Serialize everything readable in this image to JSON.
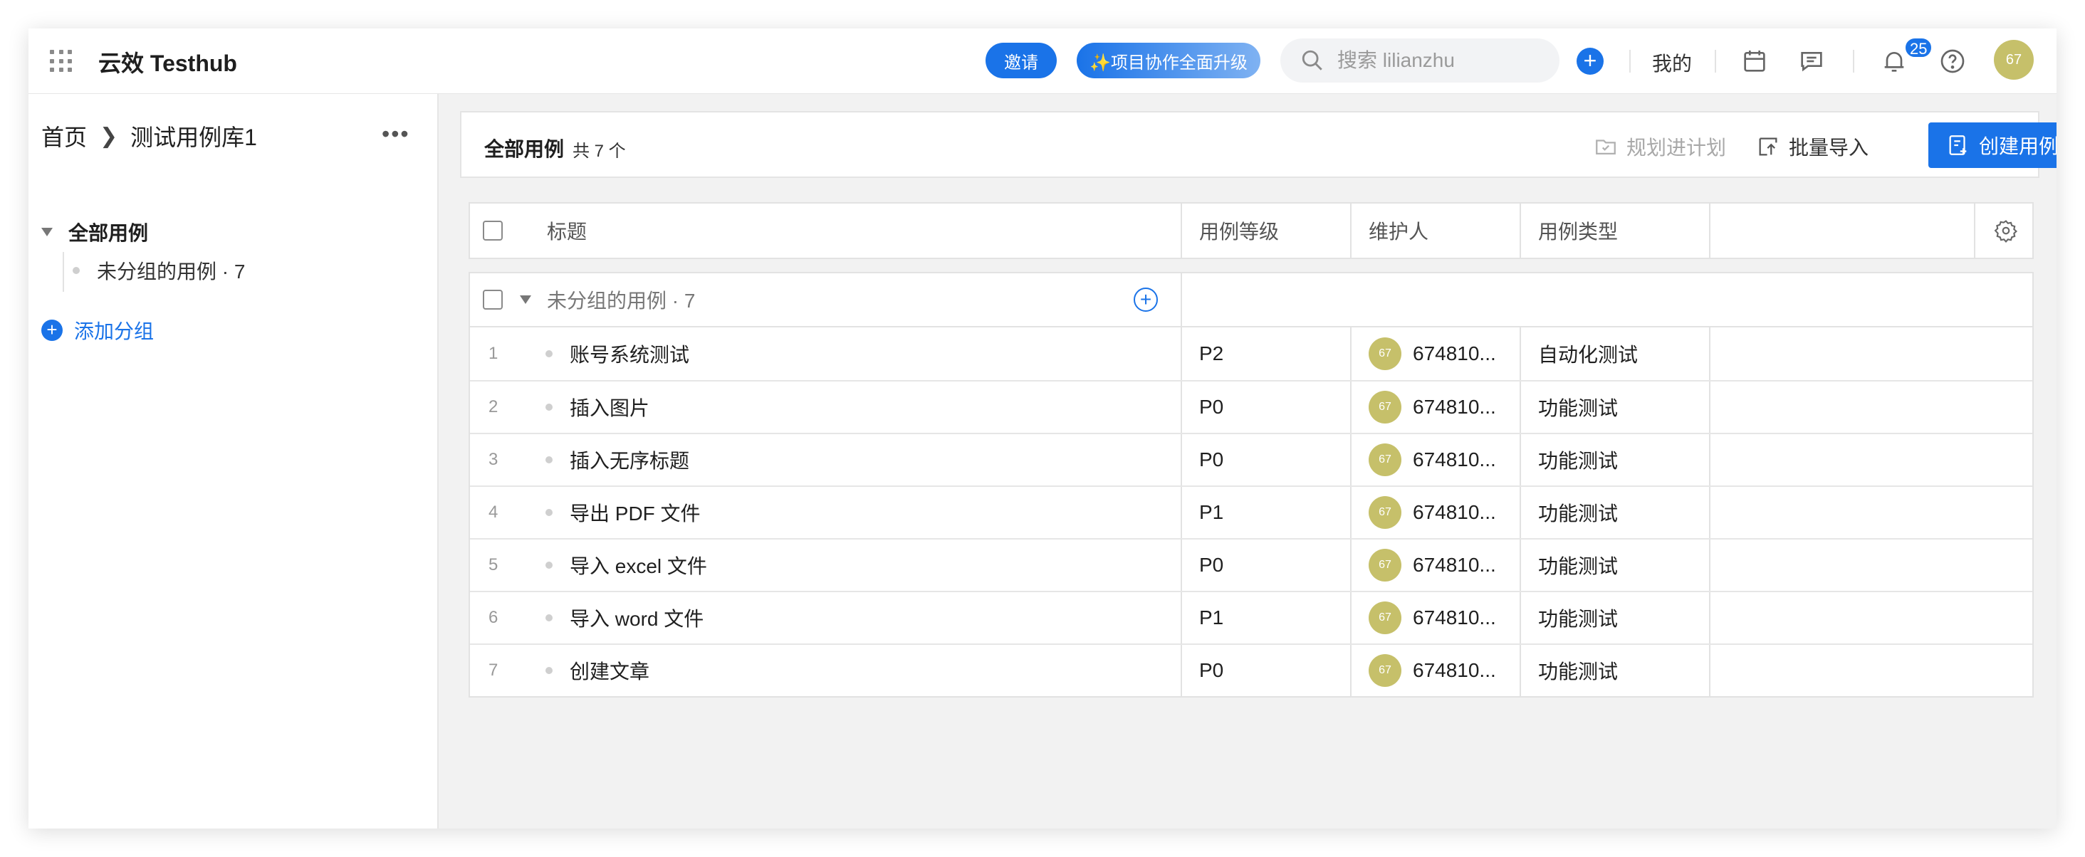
{
  "app": {
    "title": "云效 Testhub"
  },
  "topbar": {
    "invite_label": "邀请",
    "upgrade_label": "✨项目协作全面升级",
    "search_placeholder": "搜索 lilianzhu",
    "mine_label": "我的",
    "notification_count": "25",
    "avatar_text": "67"
  },
  "sidebar": {
    "breadcrumb": {
      "home": "首页",
      "library": "测试用例库1"
    },
    "tree_root": "全部用例",
    "tree_child": "未分组的用例 · 7",
    "add_group": "添加分组"
  },
  "main": {
    "title": "全部用例",
    "count": "共 7 个",
    "plan_label": "规划进计划",
    "import_label": "批量导入",
    "create_label": "创建用例"
  },
  "table": {
    "columns": {
      "title": "标题",
      "level": "用例等级",
      "maintainer": "维护人",
      "type": "用例类型"
    },
    "group_label": "未分组的用例 · 7",
    "rows": [
      {
        "num": "1",
        "title": "账号系统测试",
        "level": "P2",
        "avatar": "67",
        "maintainer": "674810...",
        "type": "自动化测试"
      },
      {
        "num": "2",
        "title": "插入图片",
        "level": "P0",
        "avatar": "67",
        "maintainer": "674810...",
        "type": "功能测试"
      },
      {
        "num": "3",
        "title": "插入无序标题",
        "level": "P0",
        "avatar": "67",
        "maintainer": "674810...",
        "type": "功能测试"
      },
      {
        "num": "4",
        "title": "导出 PDF 文件",
        "level": "P1",
        "avatar": "67",
        "maintainer": "674810...",
        "type": "功能测试"
      },
      {
        "num": "5",
        "title": "导入 excel 文件",
        "level": "P0",
        "avatar": "67",
        "maintainer": "674810...",
        "type": "功能测试"
      },
      {
        "num": "6",
        "title": "导入 word 文件",
        "level": "P1",
        "avatar": "67",
        "maintainer": "674810...",
        "type": "功能测试"
      },
      {
        "num": "7",
        "title": "创建文章",
        "level": "P0",
        "avatar": "67",
        "maintainer": "674810...",
        "type": "功能测试"
      }
    ]
  },
  "colors": {
    "accent": "#1a73e8",
    "avatar": "#c6c06a"
  }
}
